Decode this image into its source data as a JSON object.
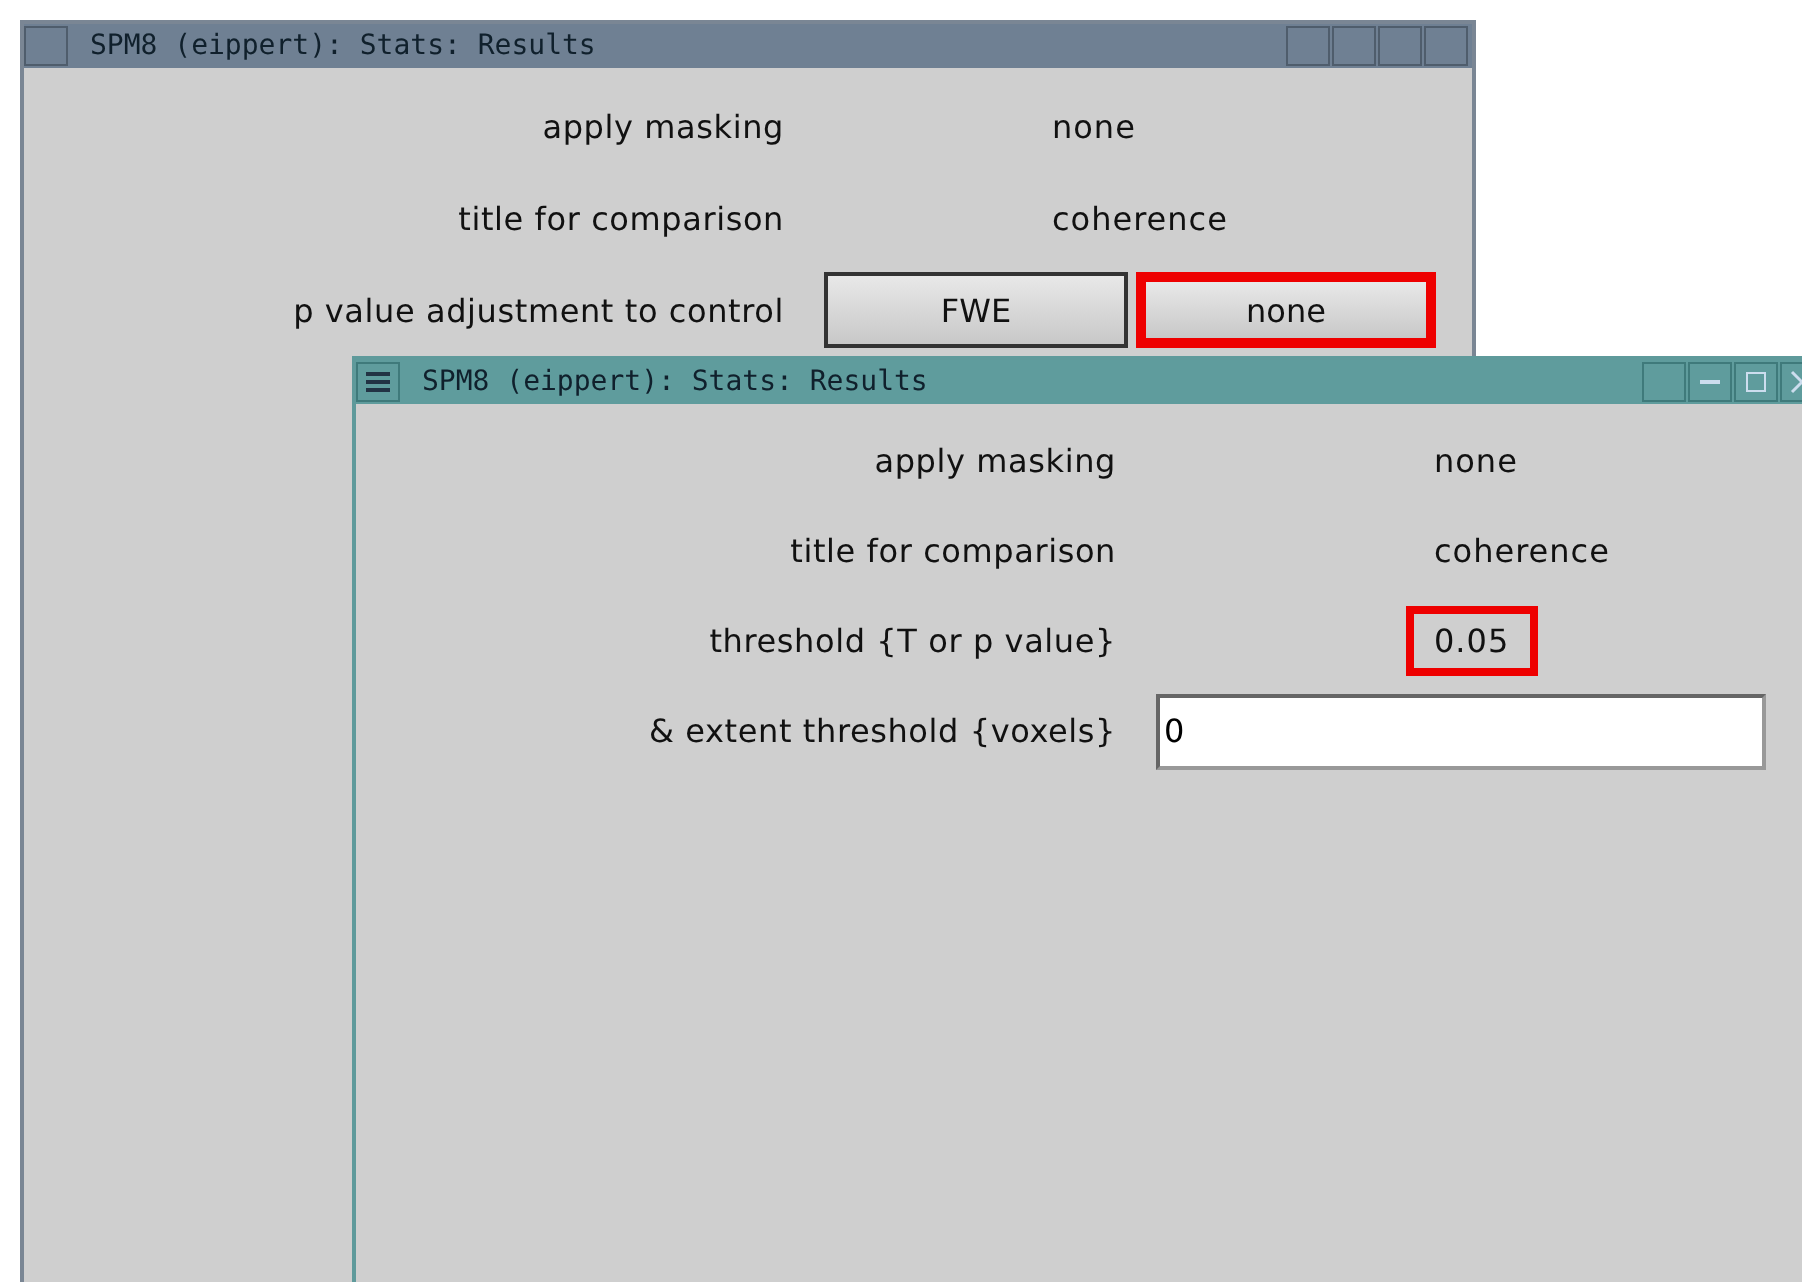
{
  "windows": [
    {
      "title": "SPM8 (eippert): Stats: Results",
      "active": false,
      "rows": [
        {
          "kind": "text",
          "label": "apply masking",
          "value": "none",
          "highlighted": false
        },
        {
          "kind": "text",
          "label": "title for comparison",
          "value": "coherence",
          "highlighted": false
        },
        {
          "kind": "buttons",
          "label": "p value adjustment to control",
          "options": [
            {
              "label": "FWE",
              "highlighted": false
            },
            {
              "label": "none",
              "highlighted": true
            }
          ]
        }
      ]
    },
    {
      "title": "SPM8 (eippert): Stats: Results",
      "active": true,
      "rows": [
        {
          "kind": "text",
          "label": "apply masking",
          "value": "none",
          "highlighted": false
        },
        {
          "kind": "text",
          "label": "title for comparison",
          "value": "coherence",
          "highlighted": false
        },
        {
          "kind": "text",
          "label": "threshold {T or p value}",
          "value": "0.05",
          "highlighted": true
        },
        {
          "kind": "input",
          "label": "& extent threshold {voxels}",
          "value": "0"
        }
      ]
    }
  ]
}
